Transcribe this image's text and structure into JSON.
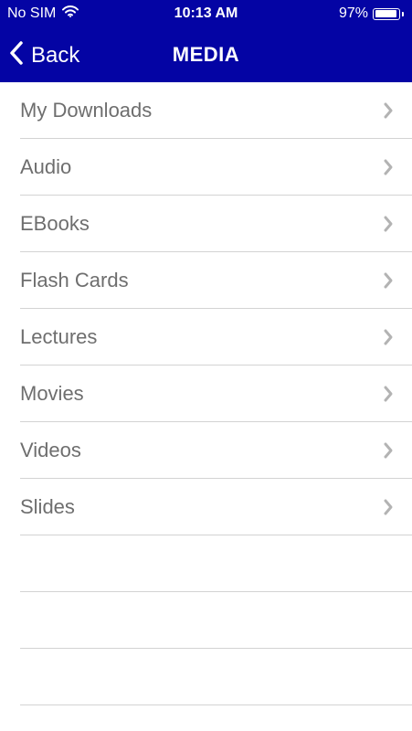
{
  "status_bar": {
    "carrier": "No SIM",
    "time": "10:13 AM",
    "battery_percent": "97%",
    "battery_level": 0.97,
    "wifi_icon": "wifi-icon",
    "battery_icon": "battery-icon"
  },
  "nav": {
    "back_label": "Back",
    "back_icon": "chevron-left-icon",
    "title": "MEDIA"
  },
  "menu": {
    "chevron_icon": "chevron-right-icon",
    "items": [
      {
        "label": "My Downloads"
      },
      {
        "label": "Audio"
      },
      {
        "label": "EBooks"
      },
      {
        "label": "Flash Cards"
      },
      {
        "label": "Lectures"
      },
      {
        "label": "Movies"
      },
      {
        "label": "Videos"
      },
      {
        "label": "Slides"
      }
    ]
  },
  "colors": {
    "header_bg": "#0404a4",
    "text_on_header": "#ffffff",
    "row_text": "#6e6e6e",
    "separator": "#d3d3d3",
    "chevron": "#b3b3b3"
  }
}
